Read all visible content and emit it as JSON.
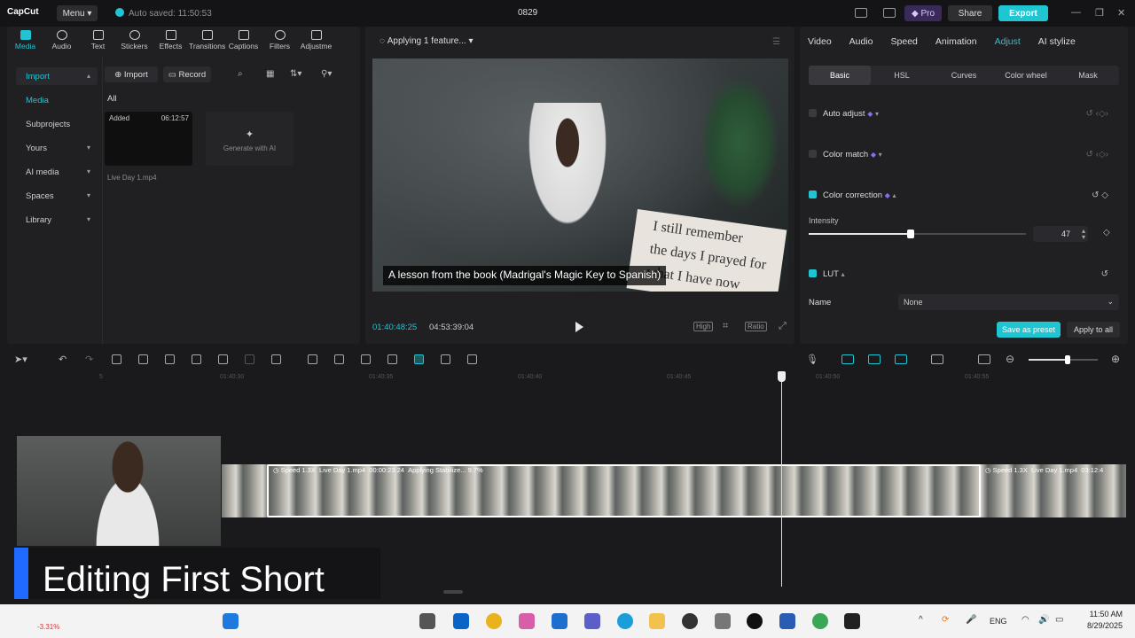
{
  "titlebar": {
    "logo": "CapCut",
    "menu_label": "Menu",
    "autosave": "Auto saved: 11:50:53",
    "project_title": "0829",
    "pro_label": "Pro",
    "share_label": "Share",
    "export_label": "Export"
  },
  "media_tools": [
    {
      "label": "Media"
    },
    {
      "label": "Audio"
    },
    {
      "label": "Text"
    },
    {
      "label": "Stickers"
    },
    {
      "label": "Effects"
    },
    {
      "label": "Transitions"
    },
    {
      "label": "Captions"
    },
    {
      "label": "Filters"
    },
    {
      "label": "Adjustme"
    }
  ],
  "sidenav": {
    "import": "Import",
    "media": "Media",
    "subprojects": "Subprojects",
    "yours": "Yours",
    "ai_media": "AI media",
    "spaces": "Spaces",
    "library": "Library"
  },
  "media_panel": {
    "import_button": "Import",
    "record_button": "Record",
    "filter_all": "All",
    "clip_added": "Added",
    "clip_duration": "06:12:57",
    "clip_name": "Live Day 1.mp4",
    "generate_ai": "Generate with AI"
  },
  "player": {
    "status": "Applying 1 feature...",
    "caption": "A lesson from the book (Madrigal's Magic Key to Spanish)",
    "book_line1": "I still remember",
    "book_line2": "the days I prayed for",
    "book_line3": "what I have now",
    "timecode_current": "01:40:48:25",
    "timecode_total": "04:53:39:04",
    "quality_label": "High",
    "ratio_label": "Ratio"
  },
  "right_panel": {
    "tabs": [
      "Video",
      "Audio",
      "Speed",
      "Animation",
      "Adjust",
      "AI stylize"
    ],
    "active_tab": "Adjust",
    "subtabs": [
      "Basic",
      "HSL",
      "Curves",
      "Color wheel",
      "Mask"
    ],
    "active_subtab": "Basic",
    "auto_adjust": "Auto adjust",
    "color_match": "Color match",
    "color_correction": "Color correction",
    "intensity_label": "Intensity",
    "intensity_value": "47",
    "lut_label": "LUT",
    "name_label": "Name",
    "name_value": "None",
    "save_preset": "Save as preset",
    "apply_all": "Apply to all"
  },
  "timeline": {
    "ruler_ticks": [
      "5",
      "01:40:30",
      "01:40:35",
      "01:40:40",
      "01:40:45",
      "01:40:50",
      "01:40:55"
    ],
    "clip_main_speed": "Speed 1.3X",
    "clip_main_name": "Live Day 1.mp4",
    "clip_main_duration": "00:00:23:24",
    "clip_main_status": "Applying Stabilize... 9.7%",
    "clip_next_speed": "Speed 1.3X",
    "clip_next_name": "Live Day 1.mp4",
    "clip_next_duration": "03:12:4"
  },
  "overlay": {
    "title": "Editing First Short"
  },
  "taskbar": {
    "lang": "ENG",
    "time": "11:50 AM",
    "date": "8/29/2025",
    "stock": "-3.31%"
  },
  "colors": {
    "accent": "#22c4d3",
    "overlay_accent": "#1f6bff",
    "premium": "#8a6cf0"
  }
}
